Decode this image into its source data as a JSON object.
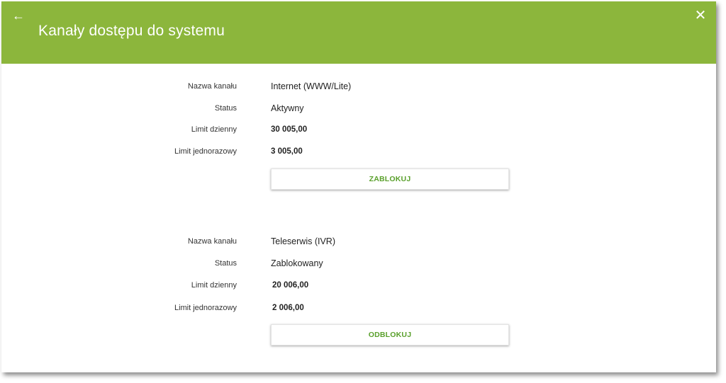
{
  "header": {
    "title": "Kanały dostępu do systemu",
    "back_icon": "arrow-left-icon",
    "close_icon": "close-icon",
    "color": "#8cb63c"
  },
  "channels": [
    {
      "name_label": "Nazwa kanału",
      "name": "Internet (WWW/Lite)",
      "status_label": "Status",
      "status": "Aktywny",
      "daily_label": "Limit dzienny",
      "daily": "30 005,00",
      "single_label": "Limit jednorazowy",
      "single": "3 005,00",
      "action": "ZABLOKUJ"
    },
    {
      "name_label": "Nazwa kanału",
      "name": "Teleserwis (IVR)",
      "status_label": "Status",
      "status": "Zablokowany",
      "daily_label": "Limit dzienny",
      "daily": "20 006,00",
      "single_label": "Limit jednorazowy",
      "single": "2 006,00",
      "action": "ODBLOKUJ"
    }
  ],
  "accent_color": "#5aa02c"
}
